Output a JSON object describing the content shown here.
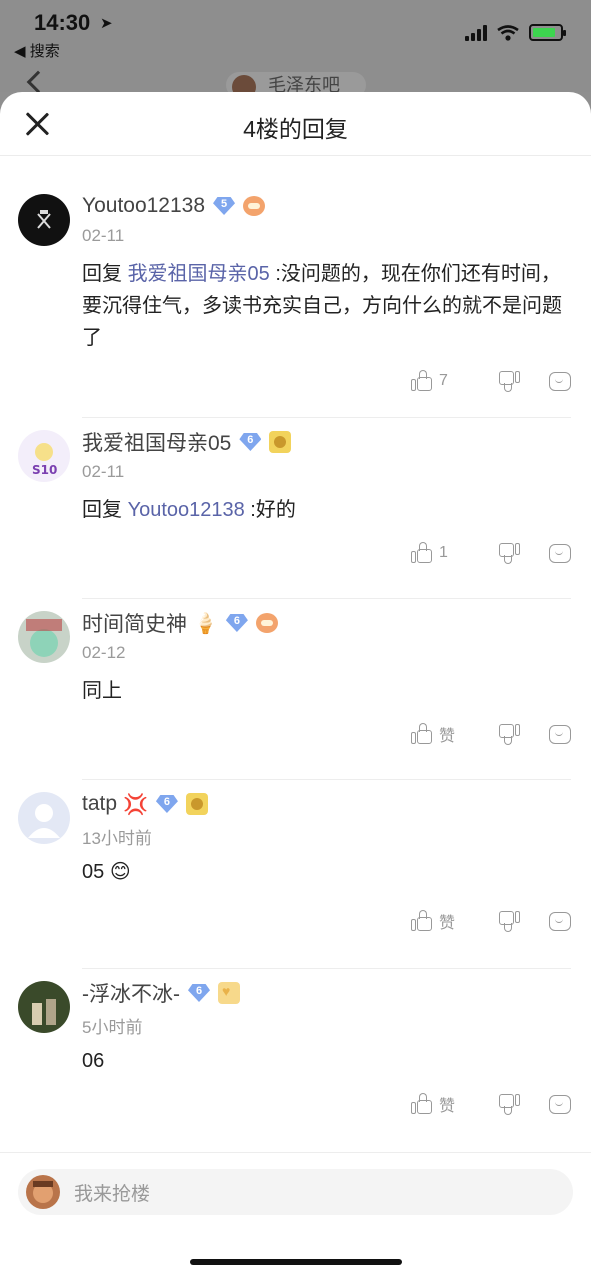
{
  "status_bar": {
    "time": "14:30",
    "back_label": "◀ 搜索"
  },
  "behind": {
    "title": "毛泽东吧"
  },
  "sheet": {
    "title": "4楼的回复"
  },
  "comments": [
    {
      "username": "Youtoo12138",
      "level": "5",
      "time": "02-11",
      "reply_prefix": "回复",
      "mention": "我爱祖国母亲05",
      "text": ":没问题的，现在你们还有时间，要沉得住气，多读书充实自己，方向什么的就不是问题了",
      "likes": "7"
    },
    {
      "username": "我爱祖国母亲05",
      "level": "6",
      "time": "02-11",
      "reply_prefix": "回复",
      "mention": "Youtoo12138",
      "text": ":好的",
      "likes": "1"
    },
    {
      "username": "时间简史神",
      "username_emoji": "🍦",
      "level": "6",
      "time": "02-12",
      "text": "同上",
      "likes": "赞"
    },
    {
      "username": "tatp",
      "username_emoji": "💢",
      "level": "6",
      "time": "13小时前",
      "text": "05",
      "text_emoji": "😊",
      "likes": "赞"
    },
    {
      "username": "-浮冰不冰-",
      "level": "6",
      "time": "5小时前",
      "text": "06",
      "likes": "赞"
    }
  ],
  "footer": {
    "placeholder": "我来抢楼"
  },
  "colors": {
    "mention": "#5a64a8",
    "gray_text": "#999999"
  }
}
